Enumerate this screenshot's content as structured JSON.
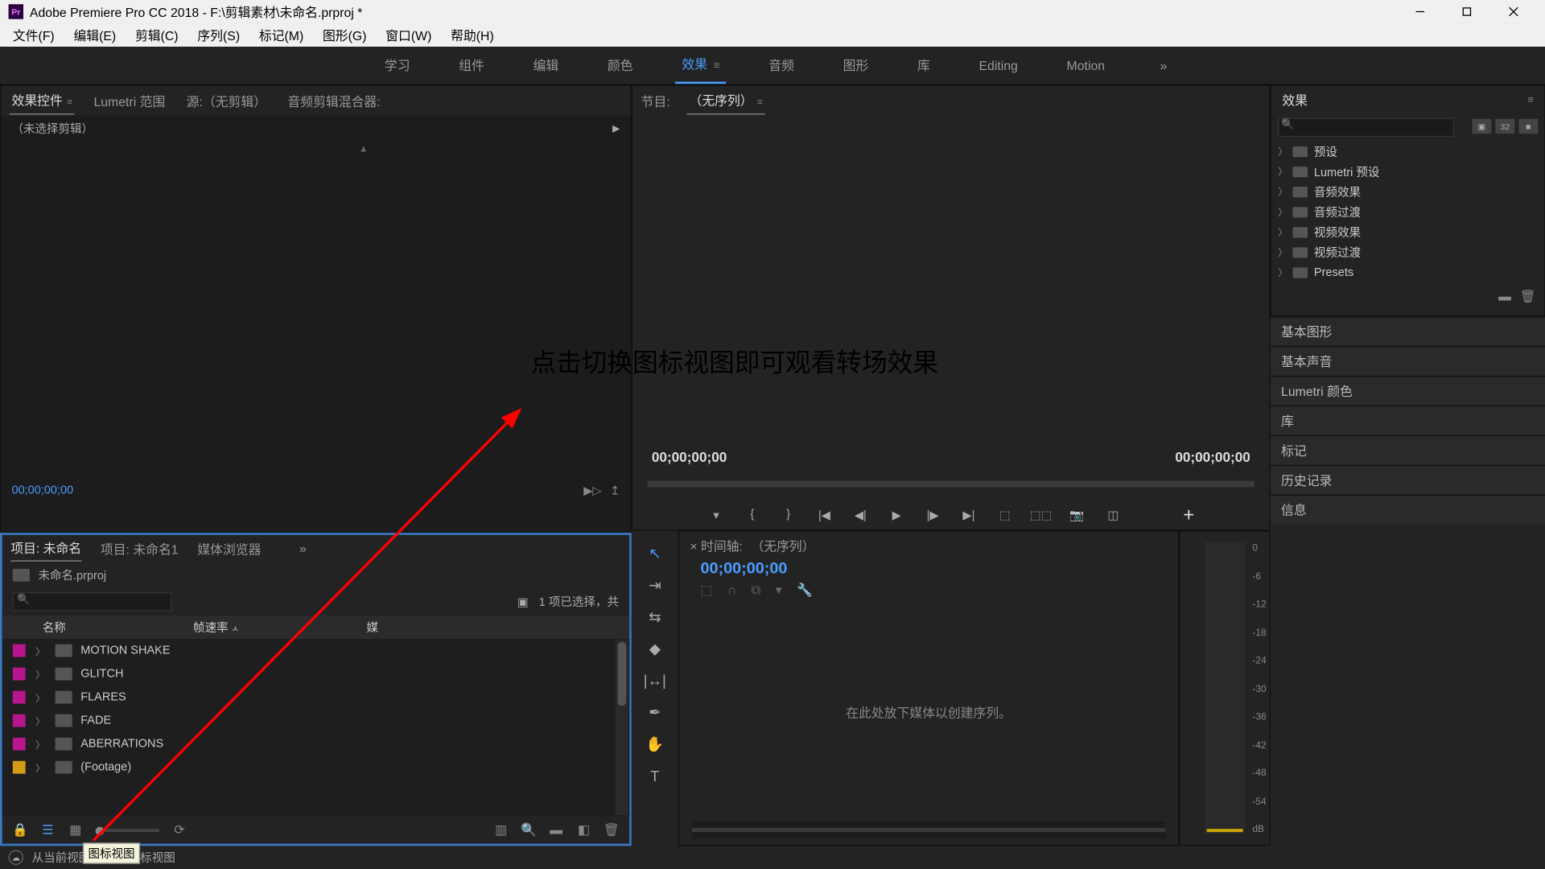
{
  "titlebar": {
    "app_icon_text": "Pr",
    "title": "Adobe Premiere Pro CC 2018 - F:\\剪辑素材\\未命名.prproj *"
  },
  "menu": {
    "items": [
      "文件(F)",
      "编辑(E)",
      "剪辑(C)",
      "序列(S)",
      "标记(M)",
      "图形(G)",
      "窗口(W)",
      "帮助(H)"
    ]
  },
  "workspaces": {
    "items": [
      "学习",
      "组件",
      "编辑",
      "颜色",
      "效果",
      "音频",
      "图形",
      "库",
      "Editing",
      "Motion"
    ],
    "active_index": 4
  },
  "source_tabs": {
    "items": [
      "效果控件",
      "Lumetri 范围",
      "源:（无剪辑）",
      "音频剪辑混合器:"
    ],
    "active_index": 0
  },
  "effect_controls": {
    "header": "（未选择剪辑）",
    "timecode": "00;00;00;00"
  },
  "project": {
    "tabs": [
      "项目: 未命名",
      "项目: 未命名1",
      "媒体浏览器"
    ],
    "active_tab": 0,
    "bin_name": "未命名.prproj",
    "selection_info": "1 项已选择，共",
    "col_name": "名称",
    "col_fps": "帧速率",
    "col_media": "媒",
    "rows": [
      {
        "swatch": "#d49b17",
        "name": "(Footage)"
      },
      {
        "swatch": "#b8168f",
        "name": "ABERRATIONS"
      },
      {
        "swatch": "#b8168f",
        "name": "FADE"
      },
      {
        "swatch": "#b8168f",
        "name": "FLARES"
      },
      {
        "swatch": "#b8168f",
        "name": "GLITCH"
      },
      {
        "swatch": "#b8168f",
        "name": "MOTION SHAKE"
      }
    ]
  },
  "program": {
    "tab_prefix": "节目:",
    "tab_label": "（无序列）",
    "timecode_left": "00;00;00;00",
    "timecode_right": "00;00;00;00"
  },
  "timeline": {
    "tab_prefix": "×  时间轴:",
    "tab_label": "（无序列）",
    "timecode": "00;00;00;00",
    "drop_hint": "在此处放下媒体以创建序列。"
  },
  "audio": {
    "ticks": [
      "0",
      "-6",
      "-12",
      "-18",
      "-24",
      "-30",
      "-36",
      "-42",
      "-48",
      "-54",
      "dB"
    ]
  },
  "effects_panel": {
    "title": "效果",
    "tree": [
      "预设",
      "Lumetri 预设",
      "音频效果",
      "音频过渡",
      "视频效果",
      "视频过渡",
      "Presets"
    ]
  },
  "side_panels": [
    "基本图形",
    "基本声音",
    "Lumetri 颜色",
    "库",
    "标记",
    "历史记录",
    "信息"
  ],
  "annotation": {
    "text": "点击切换图标视图即可观看转场效果"
  },
  "tooltip": {
    "text": "图标视图"
  },
  "status": {
    "text": "从当前视图       切换到图标视图"
  }
}
